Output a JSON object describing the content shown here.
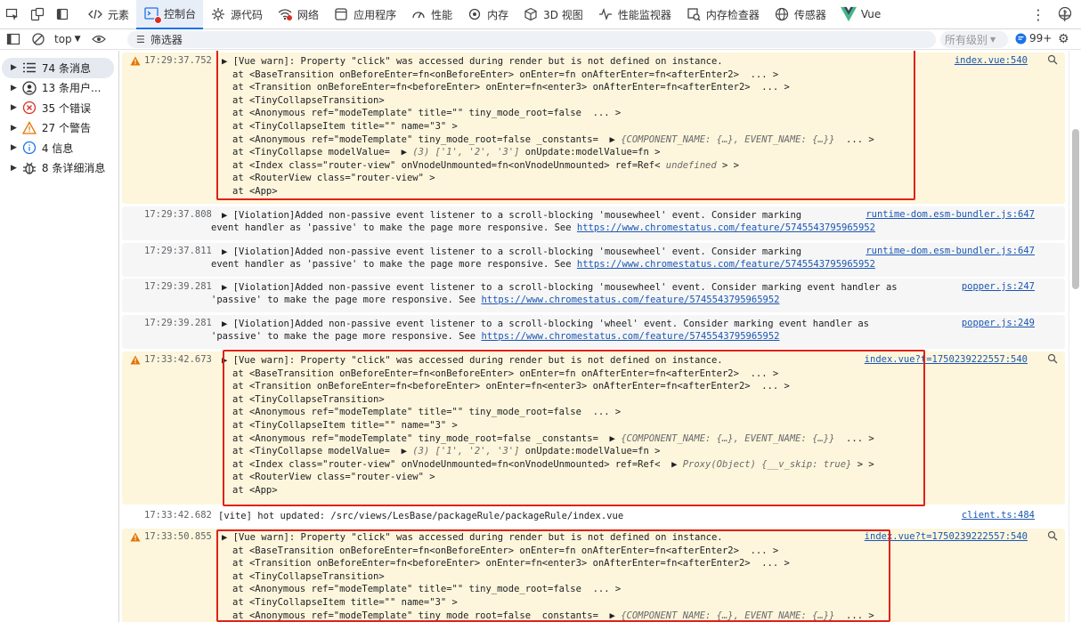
{
  "tabs": [
    {
      "label": "元素",
      "icon": "code-brackets-icon"
    },
    {
      "label": "控制台",
      "icon": "console-icon",
      "active": true
    },
    {
      "label": "源代码",
      "icon": "sources-icon"
    },
    {
      "label": "网络",
      "icon": "network-wifi-icon"
    },
    {
      "label": "应用程序",
      "icon": "application-icon"
    },
    {
      "label": "性能",
      "icon": "performance-icon"
    },
    {
      "label": "内存",
      "icon": "memory-icon"
    },
    {
      "label": "3D 视图",
      "icon": "cube-icon"
    },
    {
      "label": "性能监视器",
      "icon": "monitor-wave-icon"
    },
    {
      "label": "内存检查器",
      "icon": "memory-inspector-icon"
    },
    {
      "label": "传感器",
      "icon": "globe-icon"
    },
    {
      "label": "Vue",
      "icon": "vue-logo-icon"
    }
  ],
  "toolbar": {
    "context": "top",
    "filter_placeholder": "筛选器",
    "levels": "所有级别",
    "issues": "99+"
  },
  "sidebar": [
    {
      "label": "74 条消息",
      "icon": "list-icon",
      "selected": true
    },
    {
      "label": "13 条用户...",
      "icon": "user-circle-icon"
    },
    {
      "label": "35 个错误",
      "icon": "error-x-icon"
    },
    {
      "label": "27 个警告",
      "icon": "warning-triangle-icon"
    },
    {
      "label": "4 信息",
      "icon": "info-icon"
    },
    {
      "label": "8 条详细消息",
      "icon": "bug-icon"
    }
  ],
  "messages": [
    {
      "ts": "17:29:37.752",
      "src": "index.vue:540",
      "lines": [
        "▶ [Vue warn]: Property \"click\" was accessed during render but is not defined on instance.",
        "at <BaseTransition onBeforeEnter=fn<onBeforeEnter> onEnter=fn onAfterEnter=fn<afterEnter2>  ... >",
        "at <Transition onBeforeEnter=fn<beforeEnter> onEnter=fn<enter3> onAfterEnter=fn<afterEnter2>  ... >",
        "at <TinyCollapseTransition>",
        "at <Anonymous ref=\"modeTemplate\" title=\"\" tiny_mode_root=false  ... >",
        "at <TinyCollapseItem title=\"\" name=\"3\" >",
        "at <Anonymous ref=\"modeTemplate\" tiny_mode_root=false _constants=  ▶ {COMPONENT_NAME: {…}, EVENT_NAME: {…}}  ... >",
        "at <TinyCollapse modelValue=  ▶ (3) ['1', '2', '3'] onUpdate:modelValue=fn >",
        "at <Index class=\"router-view\" onVnodeUnmounted=fn<onVnodeUnmounted> ref=Ref< undefined > >",
        "at <RouterView class=\"router-view\" >",
        "at <App>"
      ]
    },
    {
      "ts": "17:29:37.808",
      "src": "runtime-dom.esm-bundler.js:647",
      "lines": [
        "▶ [Violation]Added non-passive event listener to a scroll-blocking 'mousewheel' event. Consider marking",
        "event handler as 'passive' to make the page more responsive. See "
      ],
      "url": "https://www.chromestatus.com/feature/5745543795965952"
    },
    {
      "ts": "17:29:37.811",
      "src": "runtime-dom.esm-bundler.js:647",
      "lines": [
        "▶ [Violation]Added non-passive event listener to a scroll-blocking 'mousewheel' event. Consider marking",
        "event handler as 'passive' to make the page more responsive. See "
      ],
      "url": "https://www.chromestatus.com/feature/5745543795965952"
    },
    {
      "ts": "17:29:39.281",
      "src": "popper.js:247",
      "lines": [
        "▶ [Violation]Added non-passive event listener to a scroll-blocking 'mousewheel' event. Consider marking event handler as",
        "'passive' to make the page more responsive. See "
      ],
      "url": "https://www.chromestatus.com/feature/5745543795965952"
    },
    {
      "ts": "17:29:39.281",
      "src": "popper.js:249",
      "lines": [
        "▶ [Violation]Added non-passive event listener to a scroll-blocking 'wheel' event. Consider marking event handler as",
        "'passive' to make the page more responsive. See "
      ],
      "url": "https://www.chromestatus.com/feature/5745543795965952"
    },
    {
      "ts": "17:33:42.673",
      "src": "index.vue?t=1750239222557:540",
      "lines": [
        "▶ [Vue warn]: Property \"click\" was accessed during render but is not defined on instance.",
        "at <BaseTransition onBeforeEnter=fn<onBeforeEnter> onEnter=fn onAfterEnter=fn<afterEnter2>  ... >",
        "at <Transition onBeforeEnter=fn<beforeEnter> onEnter=fn<enter3> onAfterEnter=fn<afterEnter2>  ... >",
        "at <TinyCollapseTransition>",
        "at <Anonymous ref=\"modeTemplate\" title=\"\" tiny_mode_root=false  ... >",
        "at <TinyCollapseItem title=\"\" name=\"3\" >",
        "at <Anonymous ref=\"modeTemplate\" tiny_mode_root=false _constants=  ▶ {COMPONENT_NAME: {…}, EVENT_NAME: {…}}  ... >",
        "at <TinyCollapse modelValue=  ▶ (3) ['1', '2', '3'] onUpdate:modelValue=fn >",
        "at <Index class=\"router-view\" onVnodeUnmounted=fn<onVnodeUnmounted> ref=Ref<  ▶ Proxy(Object) {__v_skip: true} > >",
        "at <RouterView class=\"router-view\" >",
        "at <App>"
      ]
    },
    {
      "ts": "17:33:42.682",
      "src": "client.ts:484",
      "lines": [
        "[vite] hot updated: /src/views/LesBase/packageRule/packageRule/index.vue"
      ]
    },
    {
      "ts": "17:33:50.855",
      "src": "index.vue?t=1750239222557:540",
      "lines": [
        "▶ [Vue warn]: Property \"click\" was accessed during render but is not defined on instance.",
        "at <BaseTransition onBeforeEnter=fn<onBeforeEnter> onEnter=fn onAfterEnter=fn<afterEnter2>  ... >",
        "at <Transition onBeforeEnter=fn<beforeEnter> onEnter=fn<enter3> onAfterEnter=fn<afterEnter2>  ... >",
        "at <TinyCollapseTransition>",
        "at <Anonymous ref=\"modeTemplate\" title=\"\" tiny_mode_root=false  ... >",
        "at <TinyCollapseItem title=\"\" name=\"3\" >",
        "at <Anonymous ref=\"modeTemplate\" tiny_mode_root=false _constants=  ▶ {COMPONENT_NAME: {…}, EVENT_NAME: {…}}  ... >"
      ]
    }
  ]
}
